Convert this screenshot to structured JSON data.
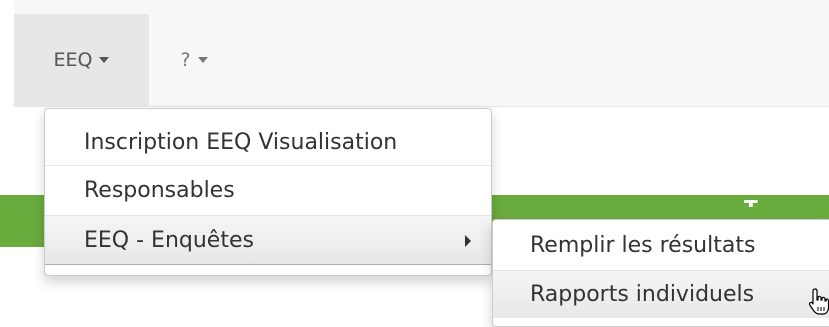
{
  "navbar": {
    "items": [
      {
        "label": "EEQ",
        "active": true
      },
      {
        "label": "?",
        "active": false
      }
    ]
  },
  "background_band": {
    "color": "#6aab3e",
    "partial_text": "T..."
  },
  "menu": {
    "items": [
      {
        "label": "Inscription EEQ Visualisation"
      },
      {
        "label": "Responsables"
      },
      {
        "label": "EEQ - Enquêtes",
        "has_submenu": true,
        "highlighted": true
      }
    ]
  },
  "submenu": {
    "items": [
      {
        "label": "Remplir les résultats"
      },
      {
        "label": "Rapports individuels",
        "hovered": true
      }
    ]
  },
  "cursor": {
    "type": "hand-pointer-icon"
  }
}
